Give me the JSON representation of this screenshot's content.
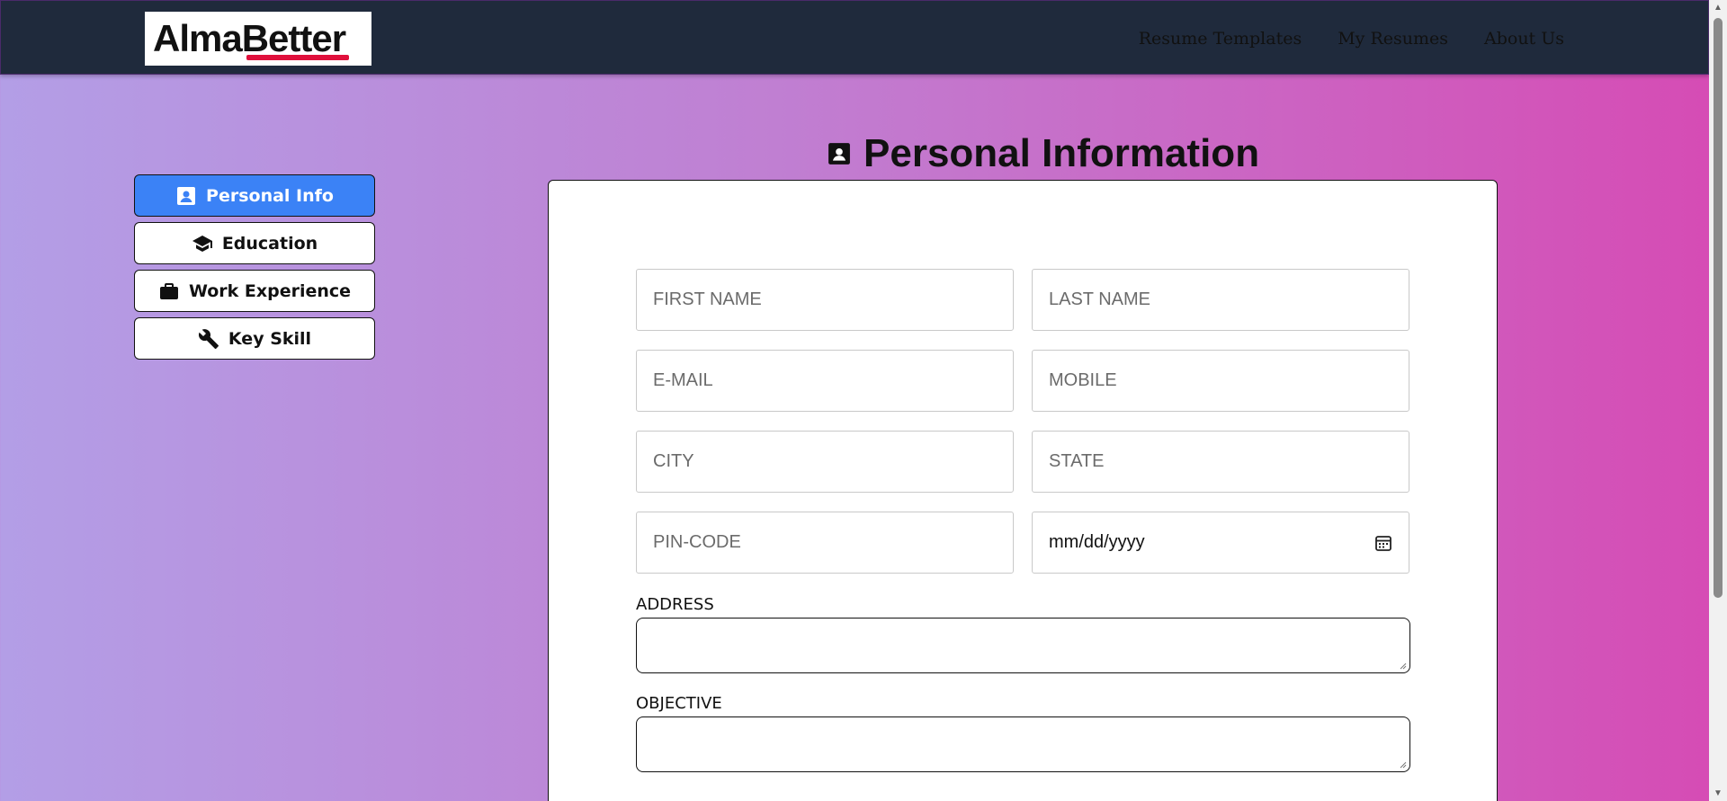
{
  "navbar": {
    "logo_text": "AlmaBetter",
    "logo_part1": "Alma",
    "logo_part2": "Better",
    "links": [
      "Resume Templates",
      "My Resumes",
      "About Us"
    ]
  },
  "sidebar": {
    "items": [
      {
        "label": "Personal Info",
        "icon": "contact-card-icon",
        "active": true
      },
      {
        "label": "Education",
        "icon": "graduation-cap-icon",
        "active": false
      },
      {
        "label": "Work Experience",
        "icon": "briefcase-icon",
        "active": false
      },
      {
        "label": "Key Skill",
        "icon": "wrench-icon",
        "active": false
      }
    ]
  },
  "page": {
    "title": "Personal Information",
    "title_icon": "contact-card-icon"
  },
  "form": {
    "first_name": {
      "placeholder": "FIRST NAME",
      "value": ""
    },
    "last_name": {
      "placeholder": "LAST NAME",
      "value": ""
    },
    "email": {
      "placeholder": "E-MAIL",
      "value": ""
    },
    "mobile": {
      "placeholder": "MOBILE",
      "value": ""
    },
    "city": {
      "placeholder": "CITY",
      "value": ""
    },
    "state": {
      "placeholder": "STATE",
      "value": ""
    },
    "pincode": {
      "placeholder": "PIN-CODE",
      "value": ""
    },
    "dob": {
      "display": "mm/dd/yyyy",
      "icon": "calendar-icon"
    },
    "address_label": "ADDRESS",
    "objective_label": "OBJECTIVE"
  },
  "colors": {
    "navbar_bg": "#1f2a3c",
    "active_button": "#3b82f6",
    "logo_accent": "#e0103c",
    "gradient_start": "#b39ee6",
    "gradient_end": "#d64bb4"
  }
}
